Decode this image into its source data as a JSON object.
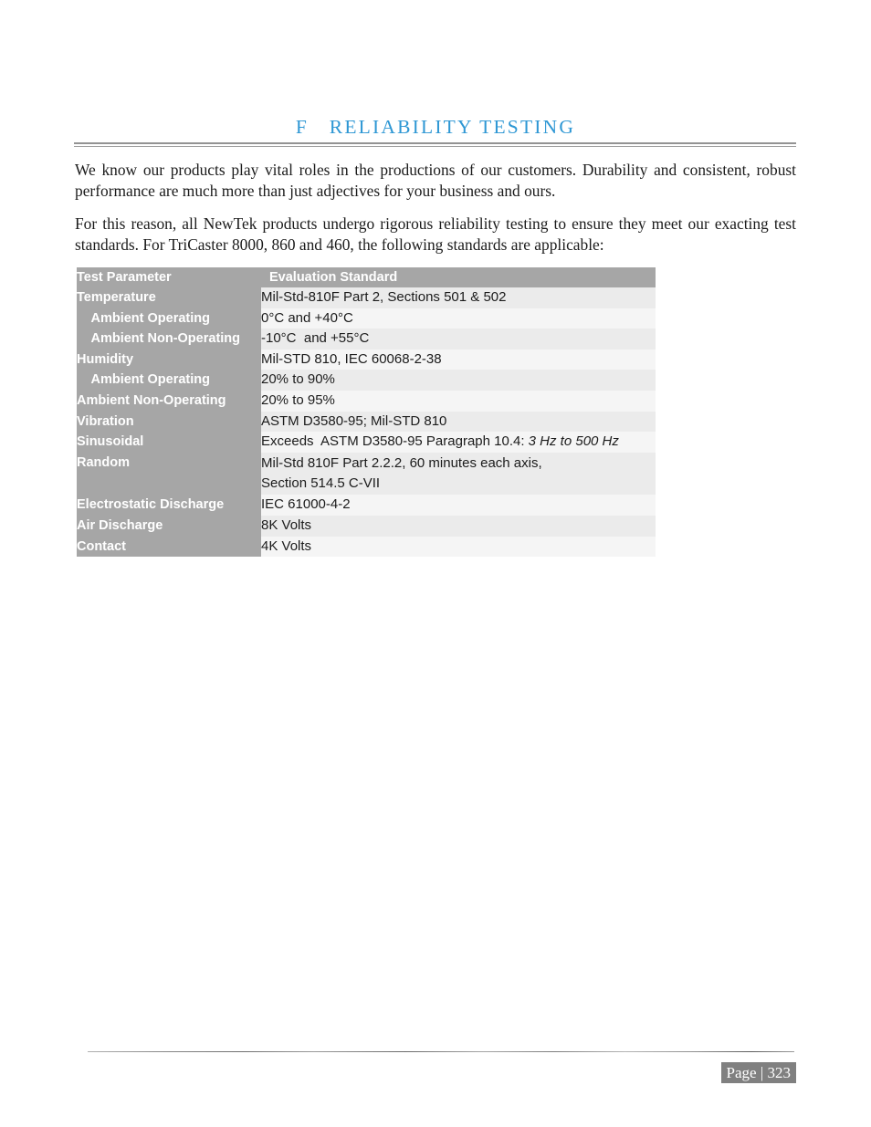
{
  "document": {
    "chapter_title": "F   RELIABILITY TESTING",
    "accent_color": "#2e97d4",
    "paragraphs": [
      "We know our products play vital roles in the productions of our customers.  Durability and consistent, robust performance are much more than just adjectives for your business and ours.",
      "For this reason, all NewTek products undergo rigorous reliability testing to ensure they meet our exacting test standards.  For TriCaster 8000, 860 and 460, the following standards are applicable:"
    ]
  },
  "table": {
    "header_bg": "#a6a6a6",
    "headers": {
      "parameter": "Test Parameter",
      "standard": "Evaluation Standard"
    },
    "rows": [
      {
        "parameter": "Temperature",
        "indent": false,
        "standard": "Mil-Std-810F Part 2, Sections 501 & 502"
      },
      {
        "parameter": " Ambient Operating",
        "indent": true,
        "standard": "0°C and +40°C"
      },
      {
        "parameter": " Ambient Non-Operating",
        "indent": true,
        "standard": "-10°C  and +55°C"
      },
      {
        "parameter": "Humidity",
        "indent": false,
        "standard": "Mil-STD 810, IEC 60068-2-38"
      },
      {
        "parameter": " Ambient Operating",
        "indent": true,
        "standard": "20% to 90%"
      },
      {
        "parameter": "Ambient Non-Operating",
        "indent": false,
        "standard": "20% to 95%"
      },
      {
        "parameter": "Vibration",
        "indent": false,
        "standard": "ASTM D3580-95; Mil-STD 810"
      },
      {
        "parameter": "Sinusoidal",
        "indent": false,
        "standard": "Exceeds  ASTM D3580-95 Paragraph 10.4: ",
        "standard_italic": "3 Hz to 500 Hz"
      },
      {
        "parameter": "Random",
        "indent": false,
        "standard": "Mil-Std 810F Part 2.2.2, 60 minutes each axis,\nSection 514.5 C-VII",
        "tall": true
      },
      {
        "parameter": "Electrostatic Discharge",
        "indent": false,
        "standard": "IEC 61000-4-2"
      },
      {
        "parameter": "Air Discharge",
        "indent": false,
        "standard": "8K Volts"
      },
      {
        "parameter": "Contact",
        "indent": false,
        "standard": "4K Volts"
      }
    ]
  },
  "footer": {
    "page_label": "Page | 323"
  }
}
